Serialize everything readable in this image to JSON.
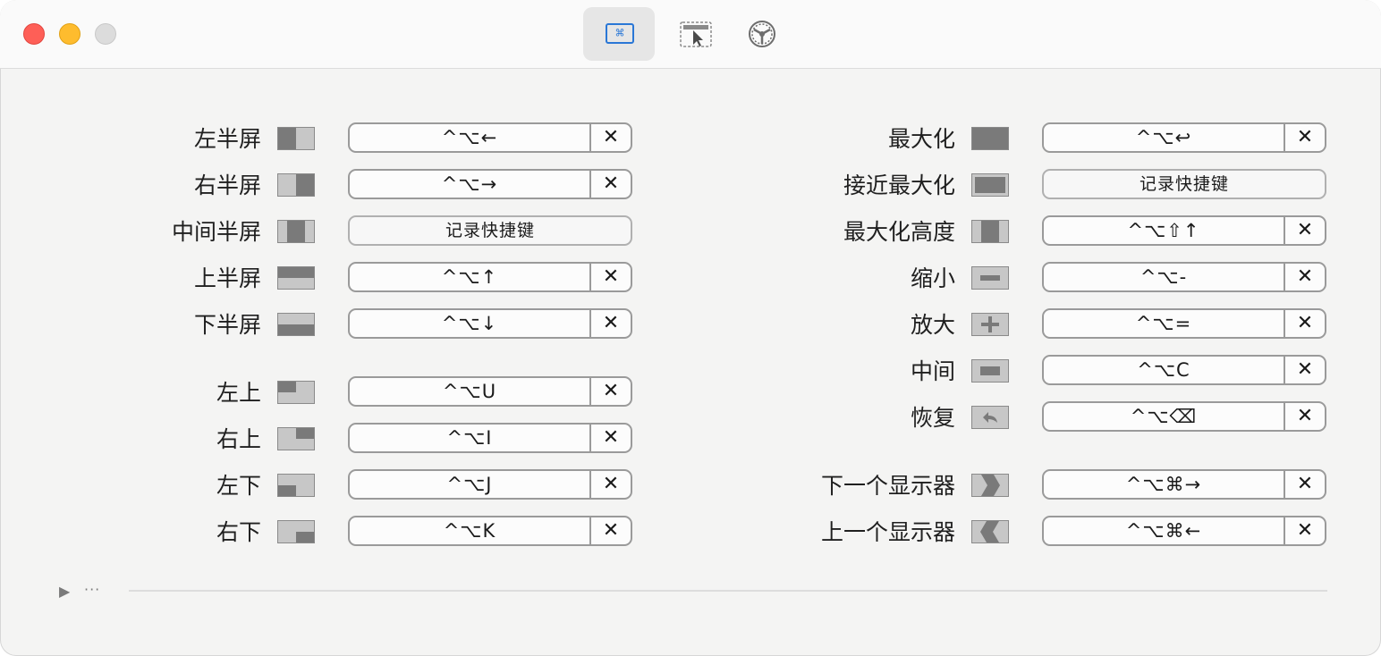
{
  "toolbar": {
    "tabs": [
      {
        "name": "shortcuts-tab",
        "icon": "keyboard-command-icon",
        "active": true
      },
      {
        "name": "snap-areas-tab",
        "icon": "window-cursor-icon",
        "active": false
      },
      {
        "name": "general-settings-tab",
        "icon": "gear-icon",
        "active": false
      }
    ]
  },
  "shortcuts": {
    "left": [
      {
        "label": "左半屏",
        "icon": "left-half-icon",
        "shortcut": "^⌥←",
        "recorded": true
      },
      {
        "label": "右半屏",
        "icon": "right-half-icon",
        "shortcut": "^⌥→",
        "recorded": true
      },
      {
        "label": "中间半屏",
        "icon": "center-half-icon",
        "shortcut": "记录快捷键",
        "recorded": false
      },
      {
        "label": "上半屏",
        "icon": "top-half-icon",
        "shortcut": "^⌥↑",
        "recorded": true
      },
      {
        "label": "下半屏",
        "icon": "bottom-half-icon",
        "shortcut": "^⌥↓",
        "recorded": true
      },
      {
        "label": "左上",
        "icon": "top-left-icon",
        "shortcut": "^⌥U",
        "recorded": true
      },
      {
        "label": "右上",
        "icon": "top-right-icon",
        "shortcut": "^⌥I",
        "recorded": true
      },
      {
        "label": "左下",
        "icon": "bottom-left-icon",
        "shortcut": "^⌥J",
        "recorded": true
      },
      {
        "label": "右下",
        "icon": "bottom-right-icon",
        "shortcut": "^⌥K",
        "recorded": true
      }
    ],
    "right": [
      {
        "label": "最大化",
        "icon": "maximize-icon",
        "shortcut": "^⌥↩",
        "recorded": true
      },
      {
        "label": "接近最大化",
        "icon": "almost-maximize-icon",
        "shortcut": "记录快捷键",
        "recorded": false
      },
      {
        "label": "最大化高度",
        "icon": "maximize-height-icon",
        "shortcut": "^⌥⇧↑",
        "recorded": true
      },
      {
        "label": "缩小",
        "icon": "make-smaller-icon",
        "shortcut": "^⌥-",
        "recorded": true
      },
      {
        "label": "放大",
        "icon": "make-larger-icon",
        "shortcut": "^⌥=",
        "recorded": true
      },
      {
        "label": "中间",
        "icon": "center-icon",
        "shortcut": "^⌥C",
        "recorded": true
      },
      {
        "label": "恢复",
        "icon": "restore-icon",
        "shortcut": "^⌥⌫",
        "recorded": true
      },
      {
        "label": "下一个显示器",
        "icon": "next-display-icon",
        "shortcut": "^⌥⌘→",
        "recorded": true
      },
      {
        "label": "上一个显示器",
        "icon": "previous-display-icon",
        "shortcut": "^⌥⌘←",
        "recorded": true
      }
    ],
    "clear_glyph": "✕"
  },
  "footer": {
    "disclosure_glyph": "▶",
    "more_label": "···"
  }
}
